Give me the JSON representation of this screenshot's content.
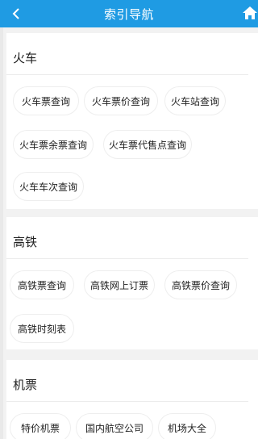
{
  "header": {
    "title": "索引导航",
    "back_icon": "chevron-left-icon",
    "home_icon": "home-icon",
    "bar_color": "#1f9be3"
  },
  "sections": [
    {
      "title": "火车",
      "items": [
        "火车票查询",
        "火车票价查询",
        "火车站查询",
        "火车票余票查询",
        "火车票代售点查询",
        "火车车次查询"
      ]
    },
    {
      "title": "高铁",
      "items": [
        "高铁票查询",
        "高铁网上订票",
        "高铁票价查询",
        "高铁时刻表"
      ]
    },
    {
      "title": "机票",
      "items": [
        "特价机票",
        "国内航空公司",
        "机场大全"
      ]
    }
  ]
}
